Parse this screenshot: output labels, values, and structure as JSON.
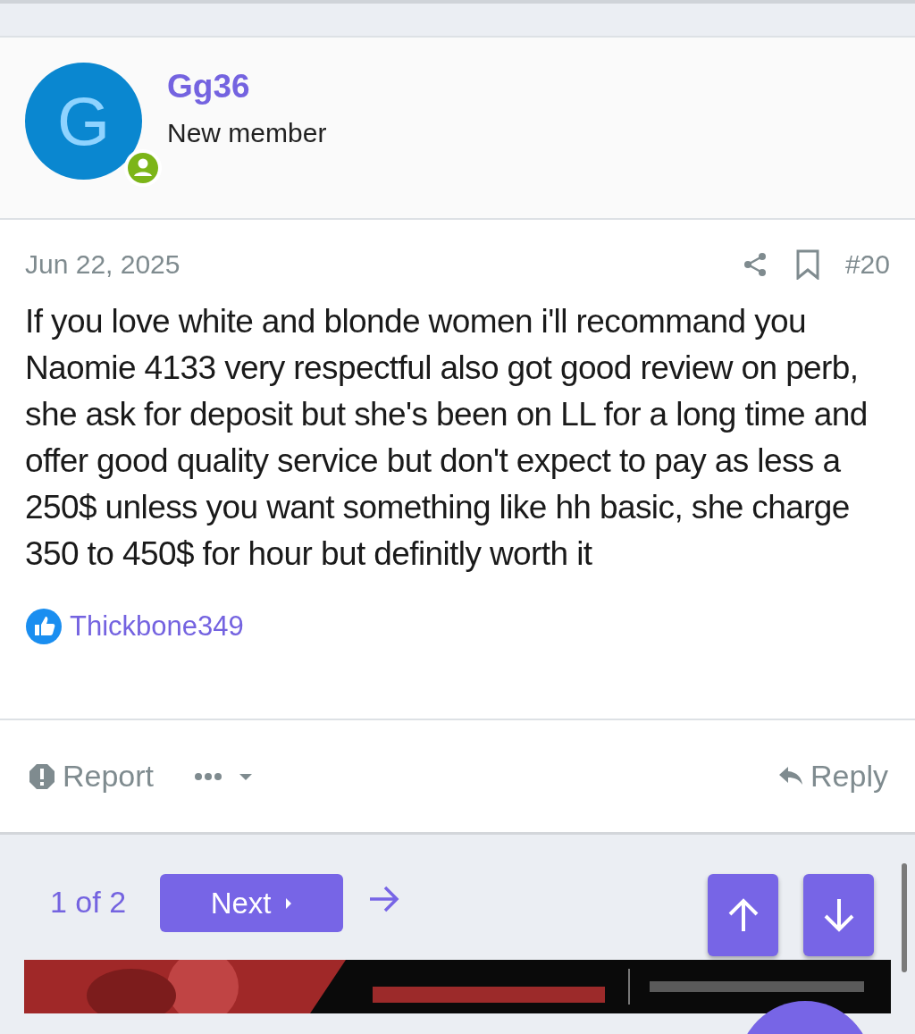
{
  "post": {
    "author": {
      "initial": "G",
      "name": "Gg36",
      "title": "New member",
      "online": true
    },
    "date": "Jun 22, 2025",
    "number": "#20",
    "body": "If you love white and blonde women i'll recommand you Naomie 4133 very respectful also got good review on perb, she ask for deposit but she's been on LL for a long time and offer good quality service but don't expect to pay as less a 250$ unless you want something like hh basic, she charge 350 to 450$ for hour but definitly worth it",
    "reactions": [
      {
        "user": "Thickbone349"
      }
    ],
    "actions": {
      "report": "Report",
      "reply": "Reply"
    }
  },
  "pagination": {
    "status": "1 of 2",
    "next": "Next"
  }
}
